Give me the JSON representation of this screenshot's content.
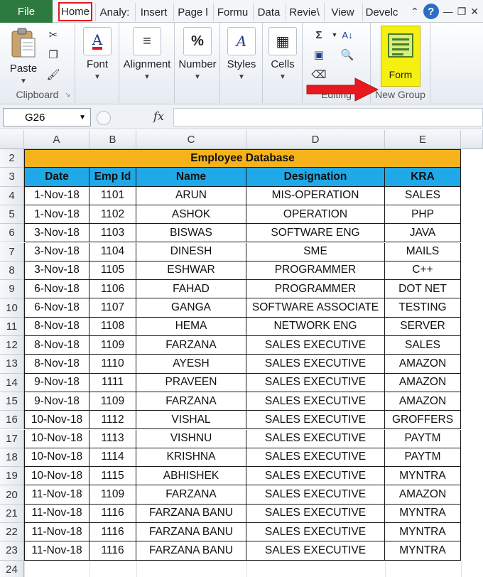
{
  "tabs": {
    "file": "File",
    "items": [
      "Home",
      "Analy:",
      "Insert",
      "Page l",
      "Formu",
      "Data",
      "Revie\\",
      "View",
      "Develc"
    ]
  },
  "ribbon": {
    "clipboard": {
      "paste": "Paste",
      "group_label": "Clipboard"
    },
    "font": "Font",
    "alignment": "Alignment",
    "number": "Number",
    "styles": "Styles",
    "cells": "Cells",
    "editing_label": "Editing",
    "form": "Form",
    "new_group_label": "New Group",
    "accent": "#f5f00f",
    "arrow_color": "#e8191e"
  },
  "formula_bar": {
    "name_box": "G26",
    "fx": "fx",
    "formula": ""
  },
  "sheet": {
    "columns": [
      "A",
      "B",
      "C",
      "D",
      "E"
    ],
    "rows": [
      "2",
      "3",
      "4",
      "5",
      "6",
      "7",
      "8",
      "9",
      "10",
      "11",
      "12",
      "13",
      "14",
      "15",
      "16",
      "17",
      "18",
      "19",
      "20",
      "21",
      "22",
      "23",
      "24"
    ],
    "title": "Employee Database",
    "headers": [
      "Date",
      "Emp Id",
      "Name",
      "Designation",
      "KRA"
    ],
    "data": [
      [
        "1-Nov-18",
        "1101",
        "ARUN",
        "MIS-OPERATION",
        "SALES"
      ],
      [
        "1-Nov-18",
        "1102",
        "ASHOK",
        "OPERATION",
        "PHP"
      ],
      [
        "3-Nov-18",
        "1103",
        "BISWAS",
        "SOFTWARE ENG",
        "JAVA"
      ],
      [
        "3-Nov-18",
        "1104",
        "DINESH",
        "SME",
        "MAILS"
      ],
      [
        "3-Nov-18",
        "1105",
        "ESHWAR",
        "PROGRAMMER",
        "C++"
      ],
      [
        "6-Nov-18",
        "1106",
        "FAHAD",
        "PROGRAMMER",
        "DOT NET"
      ],
      [
        "6-Nov-18",
        "1107",
        "GANGA",
        "SOFTWARE ASSOCIATE",
        "TESTING"
      ],
      [
        "8-Nov-18",
        "1108",
        "HEMA",
        "NETWORK ENG",
        "SERVER"
      ],
      [
        "8-Nov-18",
        "1109",
        "FARZANA",
        "SALES EXECUTIVE",
        "SALES"
      ],
      [
        "8-Nov-18",
        "1110",
        "AYESH",
        "SALES EXECUTIVE",
        "AMAZON"
      ],
      [
        "9-Nov-18",
        "1111",
        "PRAVEEN",
        "SALES EXECUTIVE",
        "AMAZON"
      ],
      [
        "9-Nov-18",
        "1109",
        "FARZANA",
        "SALES EXECUTIVE",
        "AMAZON"
      ],
      [
        "10-Nov-18",
        "1112",
        "VISHAL",
        "SALES EXECUTIVE",
        "GROFFERS"
      ],
      [
        "10-Nov-18",
        "1113",
        "VISHNU",
        "SALES EXECUTIVE",
        "PAYTM"
      ],
      [
        "10-Nov-18",
        "1114",
        "KRISHNA",
        "SALES EXECUTIVE",
        "PAYTM"
      ],
      [
        "10-Nov-18",
        "1115",
        "ABHISHEK",
        "SALES EXECUTIVE",
        "MYNTRA"
      ],
      [
        "11-Nov-18",
        "1109",
        "FARZANA",
        "SALES EXECUTIVE",
        "AMAZON"
      ],
      [
        "11-Nov-18",
        "1116",
        "FARZANA BANU",
        "SALES EXECUTIVE",
        "MYNTRA"
      ],
      [
        "11-Nov-18",
        "1116",
        "FARZANA BANU",
        "SALES EXECUTIVE",
        "MYNTRA"
      ],
      [
        "11-Nov-18",
        "1116",
        "FARZANA BANU",
        "SALES EXECUTIVE",
        "MYNTRA"
      ]
    ],
    "title_color": "#f6b21a",
    "header_color": "#1fa9e8"
  }
}
